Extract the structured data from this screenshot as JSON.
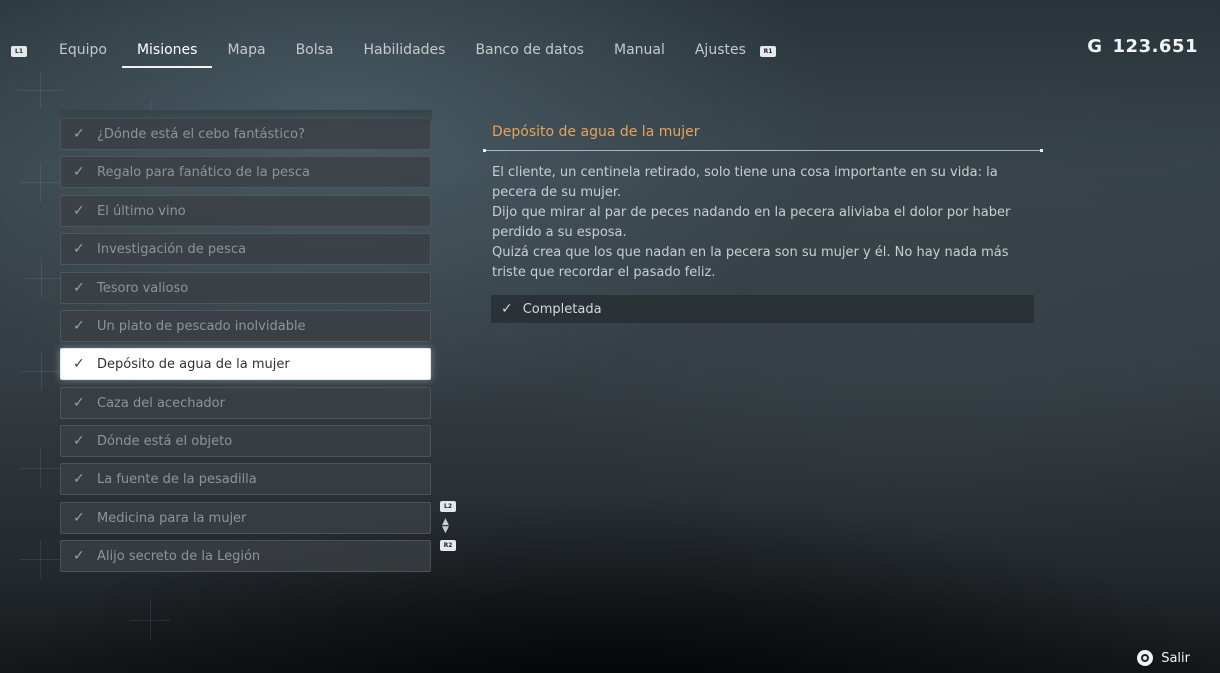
{
  "nav": {
    "left_bumper": "L1",
    "right_bumper": "R1",
    "tabs": [
      {
        "label": "Equipo"
      },
      {
        "label": "Misiones",
        "active": true
      },
      {
        "label": "Mapa"
      },
      {
        "label": "Bolsa"
      },
      {
        "label": "Habilidades"
      },
      {
        "label": "Banco de datos"
      },
      {
        "label": "Manual"
      },
      {
        "label": "Ajustes"
      }
    ],
    "currency": {
      "symbol": "G",
      "amount": "123.651"
    }
  },
  "quests": [
    {
      "name": "¿Dónde está el cebo fantástico?",
      "completed": true
    },
    {
      "name": "Regalo para fanático de la pesca",
      "completed": true
    },
    {
      "name": "El último vino",
      "completed": true
    },
    {
      "name": "Investigación de pesca",
      "completed": true
    },
    {
      "name": "Tesoro valioso",
      "completed": true
    },
    {
      "name": "Un plato de pescado inolvidable",
      "completed": true
    },
    {
      "name": "Depósito de agua de la mujer",
      "completed": true,
      "selected": true
    },
    {
      "name": "Caza del acechador",
      "completed": true
    },
    {
      "name": "Dónde está el objeto",
      "completed": true
    },
    {
      "name": "La fuente de la pesadilla",
      "completed": true
    },
    {
      "name": "Medicina para la mujer",
      "completed": true
    },
    {
      "name": "Alijo secreto de la Legión",
      "completed": true
    }
  ],
  "scroll": {
    "up_hint": "L2",
    "down_hint": "R2"
  },
  "detail": {
    "title": "Depósito de agua de la mujer",
    "paragraphs": [
      "El cliente, un centinela retirado, solo tiene una cosa importante en su vida: la pecera de su mujer.",
      "Dijo que mirar al par de peces nadando en la pecera aliviaba el dolor por haber perdido a su esposa.",
      "Quizá crea que los que nadan en la pecera son su mujer y él. No hay nada más triste que recordar el pasado feliz."
    ],
    "status": "Completada"
  },
  "footer": {
    "exit_label": "Salir"
  },
  "colors": {
    "accent": "#e8a45a",
    "selected_bg": "#ffffff"
  }
}
